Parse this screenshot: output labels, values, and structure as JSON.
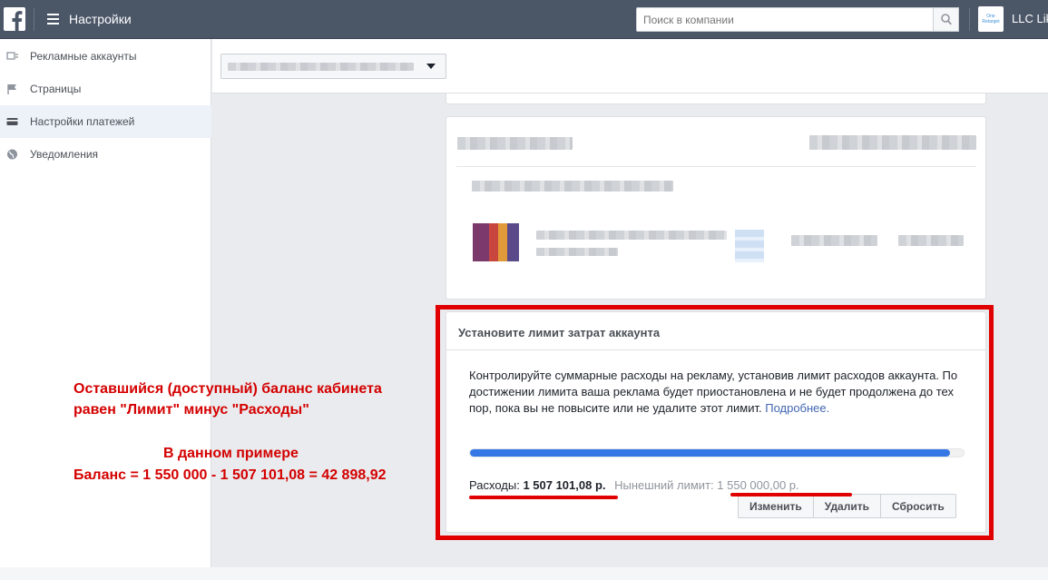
{
  "app": {
    "title": "Настройки"
  },
  "search": {
    "placeholder": "Поиск в компании"
  },
  "business": {
    "name": "LLC Lik",
    "logo_text": "One Retarget"
  },
  "sidebar": {
    "items": [
      {
        "label": "Рекламные аккаунты",
        "icon": "ad-accounts-icon",
        "active": false
      },
      {
        "label": "Страницы",
        "icon": "flag-icon",
        "active": false
      },
      {
        "label": "Настройки платежей",
        "icon": "credit-card-icon",
        "active": true
      },
      {
        "label": "Уведомления",
        "icon": "globe-icon",
        "active": false
      }
    ]
  },
  "limit_card": {
    "title": "Установите лимит затрат аккаунта",
    "description": "Контролируйте суммарные расходы на рекламу, установив лимит расходов аккаунта. По достижении лимита ваша реклама будет приостановлена и не будет продолжена до тех пор, пока вы не повысите или не удалите этот лимит.",
    "learn_more": "Подробнее.",
    "progress_fraction": 0.9723,
    "spend_label": "Расходы:",
    "spend_value": "1 507 101,08 р.",
    "limit_label": "Нынешний лимит:",
    "limit_value": "1 550 000,00 р.",
    "buttons": {
      "change": "Изменить",
      "delete": "Удалить",
      "reset": "Сбросить"
    }
  },
  "annotation": {
    "line1": "Оставшийся (доступный) баланс кабинета",
    "line2": "равен \"Лимит\" минус \"Расходы\"",
    "line3": "В данном примере",
    "line4": "Баланс = 1 550 000 - 1 507 101,08 = 42 898,92"
  },
  "colors": {
    "topbar": "#4b5667",
    "accent": "#3578e5",
    "annotation_red": "#e00000"
  }
}
